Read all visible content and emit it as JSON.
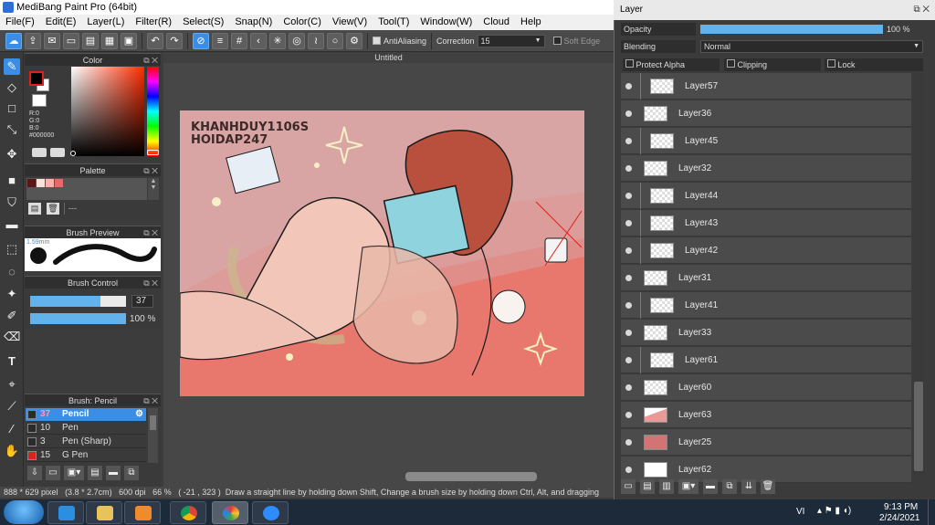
{
  "window": {
    "title": "MediBang Paint Pro (64bit)"
  },
  "menu": [
    "File(F)",
    "Edit(E)",
    "Layer(L)",
    "Filter(R)",
    "Select(S)",
    "Snap(N)",
    "Color(C)",
    "View(V)",
    "Tool(T)",
    "Window(W)",
    "Cloud",
    "Help"
  ],
  "toolbar": {
    "antialiasing_label": "AntiAliasing",
    "correction_label": "Correction",
    "correction_value": "15",
    "soft_edge_label": "Soft Edge"
  },
  "color_panel": {
    "title": "Color",
    "r": "R:0",
    "g": "G:0",
    "b": "B:0",
    "hex": "#000000",
    "foreground_color": "#000000",
    "background_color": "#ffffff",
    "accent_color": "#e0201f"
  },
  "palette_panel": {
    "title": "Palette",
    "name_placeholder": "---",
    "swatches": [
      "#5a1616",
      "#f7e3dc",
      "#f2b5ae",
      "#e56a6a"
    ]
  },
  "brush_preview": {
    "title": "Brush Preview",
    "size_label": "1.59mm"
  },
  "brush_control": {
    "title": "Brush Control",
    "size": "37",
    "opacity": "100 %",
    "size_fraction": 0.73,
    "opacity_fraction": 1.0
  },
  "brush_list": {
    "title": "Brush: Pencil",
    "items": [
      {
        "size": "37",
        "name": "Pencil",
        "color": "#2b2b2b",
        "selected": true
      },
      {
        "size": "10",
        "name": "Pen",
        "color": "#2b2b2b",
        "selected": false
      },
      {
        "size": "3",
        "name": "Pen (Sharp)",
        "color": "#2b2b2b",
        "selected": false
      },
      {
        "size": "15",
        "name": "G Pen",
        "color": "#e0201f",
        "selected": false
      }
    ]
  },
  "document": {
    "tab_title": "Untitled"
  },
  "canvas_art": {
    "watermark_line1": "KHANHDUY1106S",
    "watermark_line2": "HOIDAP247",
    "background_color": "#d9a4a4",
    "floor_color": "#e8776e"
  },
  "status": {
    "size": "888 * 629 pixel",
    "cm": "(3.8 * 2.7cm)",
    "dpi": "600 dpi",
    "zoom": "66 %",
    "coords": "( -21 , 323 )",
    "hint": "Draw a straight line by holding down Shift, Change a brush size by holding down Ctrl, Alt, and dragging"
  },
  "layer_panel": {
    "title": "Layer",
    "opacity_label": "Opacity",
    "opacity_value": "100 %",
    "opacity_fraction": 1.0,
    "blending_label": "Blending",
    "blending_value": "Normal",
    "protect_alpha_label": "Protect Alpha",
    "clipping_label": "Clipping",
    "lock_label": "Lock",
    "layers": [
      {
        "name": "Layer57",
        "clipped": true,
        "thumb": "checker"
      },
      {
        "name": "Layer36",
        "clipped": false,
        "thumb": "checker"
      },
      {
        "name": "Layer45",
        "clipped": true,
        "thumb": "checker"
      },
      {
        "name": "Layer32",
        "clipped": false,
        "thumb": "checker"
      },
      {
        "name": "Layer44",
        "clipped": true,
        "thumb": "checker"
      },
      {
        "name": "Layer43",
        "clipped": true,
        "thumb": "checker"
      },
      {
        "name": "Layer42",
        "clipped": true,
        "thumb": "checker"
      },
      {
        "name": "Layer31",
        "clipped": false,
        "thumb": "checker"
      },
      {
        "name": "Layer41",
        "clipped": true,
        "thumb": "checker"
      },
      {
        "name": "Layer33",
        "clipped": false,
        "thumb": "checker"
      },
      {
        "name": "Layer61",
        "clipped": true,
        "thumb": "checker"
      },
      {
        "name": "Layer60",
        "clipped": false,
        "thumb": "checker"
      },
      {
        "name": "Layer63",
        "clipped": false,
        "thumb": "pink"
      },
      {
        "name": "Layer25",
        "clipped": false,
        "thumb": "#d27474"
      },
      {
        "name": "Layer62",
        "clipped": false,
        "thumb": "#ffffff"
      }
    ]
  },
  "taskbar": {
    "language": "VI",
    "time": "9:13 PM",
    "date": "2/24/2021"
  }
}
